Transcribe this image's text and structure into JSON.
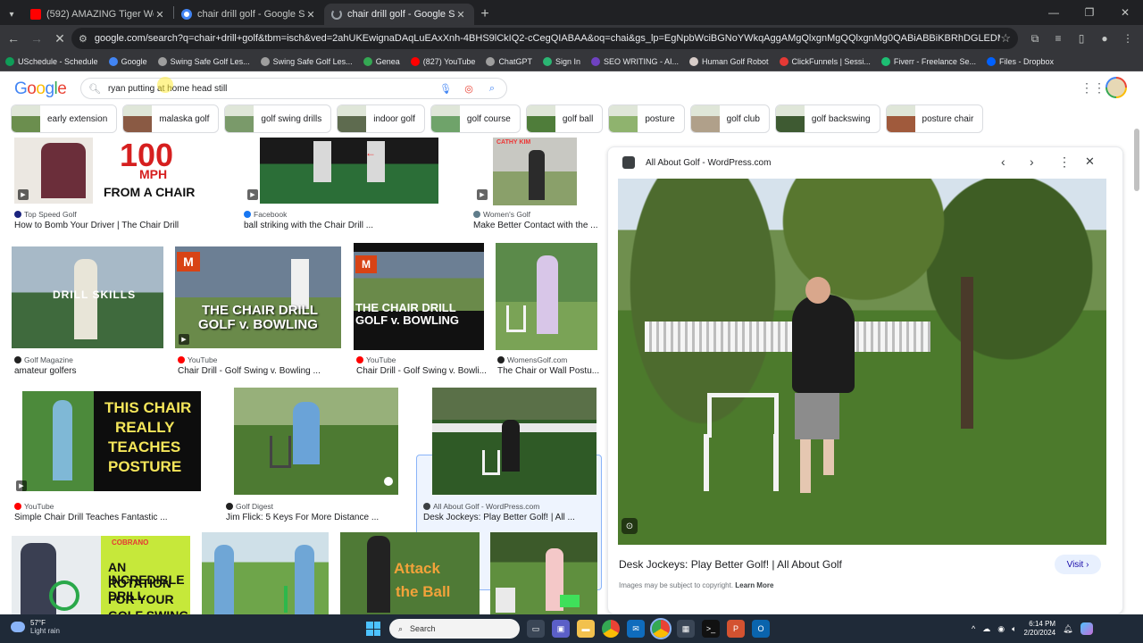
{
  "tabs": [
    {
      "title": "(592) AMAZING Tiger Woods' F",
      "color": "#ff0000"
    },
    {
      "title": "chair drill golf - Google Search",
      "color": "#4285f4"
    },
    {
      "title": "chair drill golf - Google Search",
      "color": "#9aa0a6"
    }
  ],
  "omnibox": {
    "url": "google.com/search?q=chair+drill+golf&tbm=isch&ved=2ahUKEwignaDAqLuEAxXnh-4BHS9lCkIQ2-cCegQIABAA&oq=chai&gs_lp=EgNpbWciBGNoYWkqAggAMgQlxgnMgQQlxgnMg0QABiABBiKBRhDGLEDMgoQABiABBiKBRhDMgoQABiABBi..."
  },
  "bookmarks": [
    {
      "label": "USchedule - Schedule",
      "color": "#0f9d58"
    },
    {
      "label": "Google",
      "color": "#4285f4"
    },
    {
      "label": "Swing Safe Golf Les...",
      "color": "#9e9e9e"
    },
    {
      "label": "Swing Safe Golf Les...",
      "color": "#9e9e9e"
    },
    {
      "label": "Genea",
      "color": "#34a853"
    },
    {
      "label": "(827) YouTube",
      "color": "#ff0000"
    },
    {
      "label": "ChatGPT",
      "color": "#9e9e9e"
    },
    {
      "label": "Sign In",
      "color": "#2bb673"
    },
    {
      "label": "SEO WRITING - AI...",
      "color": "#6f42c1"
    },
    {
      "label": "Human Golf Robot",
      "color": "#d7ccc8"
    },
    {
      "label": "ClickFunnels | Sessi...",
      "color": "#e53935"
    },
    {
      "label": "Fiverr - Freelance Se...",
      "color": "#1dbf73"
    },
    {
      "label": "Files - Dropbox",
      "color": "#0061ff"
    }
  ],
  "search": {
    "query": "ryan putting at home head still"
  },
  "chips": [
    {
      "label": "early extension",
      "color": "#6b8e4e"
    },
    {
      "label": "malaska golf",
      "color": "#8a5a44"
    },
    {
      "label": "golf swing drills",
      "color": "#7a9a6a"
    },
    {
      "label": "indoor golf",
      "color": "#5e6b4f"
    },
    {
      "label": "golf course",
      "color": "#6fa36a"
    },
    {
      "label": "golf ball",
      "color": "#4f7d3a"
    },
    {
      "label": "posture",
      "color": "#8fb36e"
    },
    {
      "label": "golf club",
      "color": "#b0a08a"
    },
    {
      "label": "golf backswing",
      "color": "#3e5a32"
    },
    {
      "label": "posture chair",
      "color": "#a05a3c"
    }
  ],
  "results": [
    {
      "source": "Top Speed Golf",
      "caption": "How to Bomb Your Driver | The Chair Drill",
      "overlay": "100\nMPH\nFROM A CHAIR",
      "src_color": "#1a237e"
    },
    {
      "source": "Facebook",
      "caption": "ball striking with the Chair Drill ...",
      "src_color": "#1877f2"
    },
    {
      "source": "Women's Golf",
      "caption": "Make Better Contact with the ...",
      "overlay": "CATHY KIM",
      "src_color": "#607d8b"
    },
    {
      "source": "Golf Magazine",
      "caption": "amateur golfers",
      "overlay": "DRILL SKILLS",
      "src_color": "#212121"
    },
    {
      "source": "YouTube",
      "caption": "Chair Drill - Golf Swing v. Bowling ...",
      "overlay": "THE CHAIR DRILL\nGOLF v. BOWLING",
      "src_color": "#ff0000"
    },
    {
      "source": "YouTube",
      "caption": "Chair Drill - Golf Swing v. Bowli...",
      "overlay": "THE CHAIR DRILL\nGOLF v. BOWLING",
      "src_color": "#ff0000"
    },
    {
      "source": "WomensGolf.com",
      "caption": "The Chair or Wall Postu...",
      "src_color": "#212121"
    },
    {
      "source": "YouTube",
      "caption": "Simple Chair Drill Teaches Fantastic ...",
      "overlay": "THIS CHAIR\nREALLY\nTEACHES\nPOSTURE",
      "src_color": "#ff0000"
    },
    {
      "source": "Golf Digest",
      "caption": "Jim Flick: 5 Keys For More Distance ...",
      "src_color": "#212121"
    },
    {
      "source": "All About Golf - WordPress.com",
      "caption": "Desk Jockeys: Play Better Golf! | All ...",
      "src_color": "#3c4043"
    },
    {
      "overlay": "AN INCREDIBLE\nROTATION DRILL\nFOR YOUR\nGOLF SWING",
      "brand": "COBRANO"
    },
    {},
    {
      "overlay": "Attack\nthe Ball"
    },
    {}
  ],
  "panel": {
    "site": "All About Golf - WordPress.com",
    "title": "Desk Jockeys: Play Better Golf! | All About Golf",
    "visit": "Visit",
    "copyright": "Images may be subject to copyright.",
    "learn_more": "Learn More"
  },
  "taskbar": {
    "temp": "57°F",
    "weather": "Light rain",
    "search": "Search",
    "time": "6:14 PM",
    "date": "2/20/2024"
  }
}
